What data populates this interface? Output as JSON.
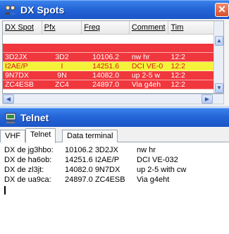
{
  "dx_window": {
    "title": "DX Spots",
    "close_glyph": "✕",
    "columns": [
      "DX Spot",
      "Pfx",
      "Freq",
      "Comment",
      "Tim"
    ],
    "rows": [
      {
        "spot": "",
        "pfx": "",
        "freq": "",
        "comment": "",
        "time": "",
        "style": "empty"
      },
      {
        "spot": "",
        "pfx": "",
        "freq": "",
        "comment": "",
        "time": "",
        "style": "blank-red"
      },
      {
        "spot": "3D2JX",
        "pfx": "3D2",
        "freq": "10106.2",
        "comment": "nw hr",
        "time": "12:2",
        "style": "red"
      },
      {
        "spot": "I2AE/P",
        "pfx": "I",
        "freq": "14251.6",
        "comment": "DCI VE-0",
        "time": "12:2",
        "style": "yellow"
      },
      {
        "spot": "9N7DX",
        "pfx": "9N",
        "freq": "14082.0",
        "comment": "up 2-5 w",
        "time": "12:2",
        "style": "red"
      },
      {
        "spot": "ZC4ESB",
        "pfx": "ZC4",
        "freq": "24897.0",
        "comment": "Via g4eh",
        "time": "12:2",
        "style": "red"
      }
    ],
    "scroll_up_glyph": "▲",
    "scroll_down_glyph": "▼",
    "scroll_left_glyph": "◀",
    "scroll_right_glyph": "▶"
  },
  "telnet_window": {
    "title": "Telnet",
    "tabs": [
      "VHF",
      "Telnet",
      "Data terminal"
    ],
    "active_tab": "Telnet",
    "lines": [
      {
        "from": "DX de jg3hbo:",
        "freq_call": "10106.2  3D2JX",
        "comment": "nw hr"
      },
      {
        "from": "DX de ha6ob:",
        "freq_call": "14251.6  I2AE/P",
        "comment": "DCI VE-032"
      },
      {
        "from": "DX de zl3jt:",
        "freq_call": "14082.0  9N7DX",
        "comment": "up 2-5 with cw"
      },
      {
        "from": "DX de ua9ca:",
        "freq_call": "24897.0  ZC4ESB",
        "comment": "Via g4eht"
      }
    ]
  },
  "icons": {
    "dx_title_icon": "people-icon",
    "telnet_title_icon": "computer-icon"
  },
  "colors": {
    "titlebar": "#2565d8",
    "row_red": "#f0373d",
    "row_yellow": "#f4f33a",
    "yellow_text": "#d21b1b"
  }
}
